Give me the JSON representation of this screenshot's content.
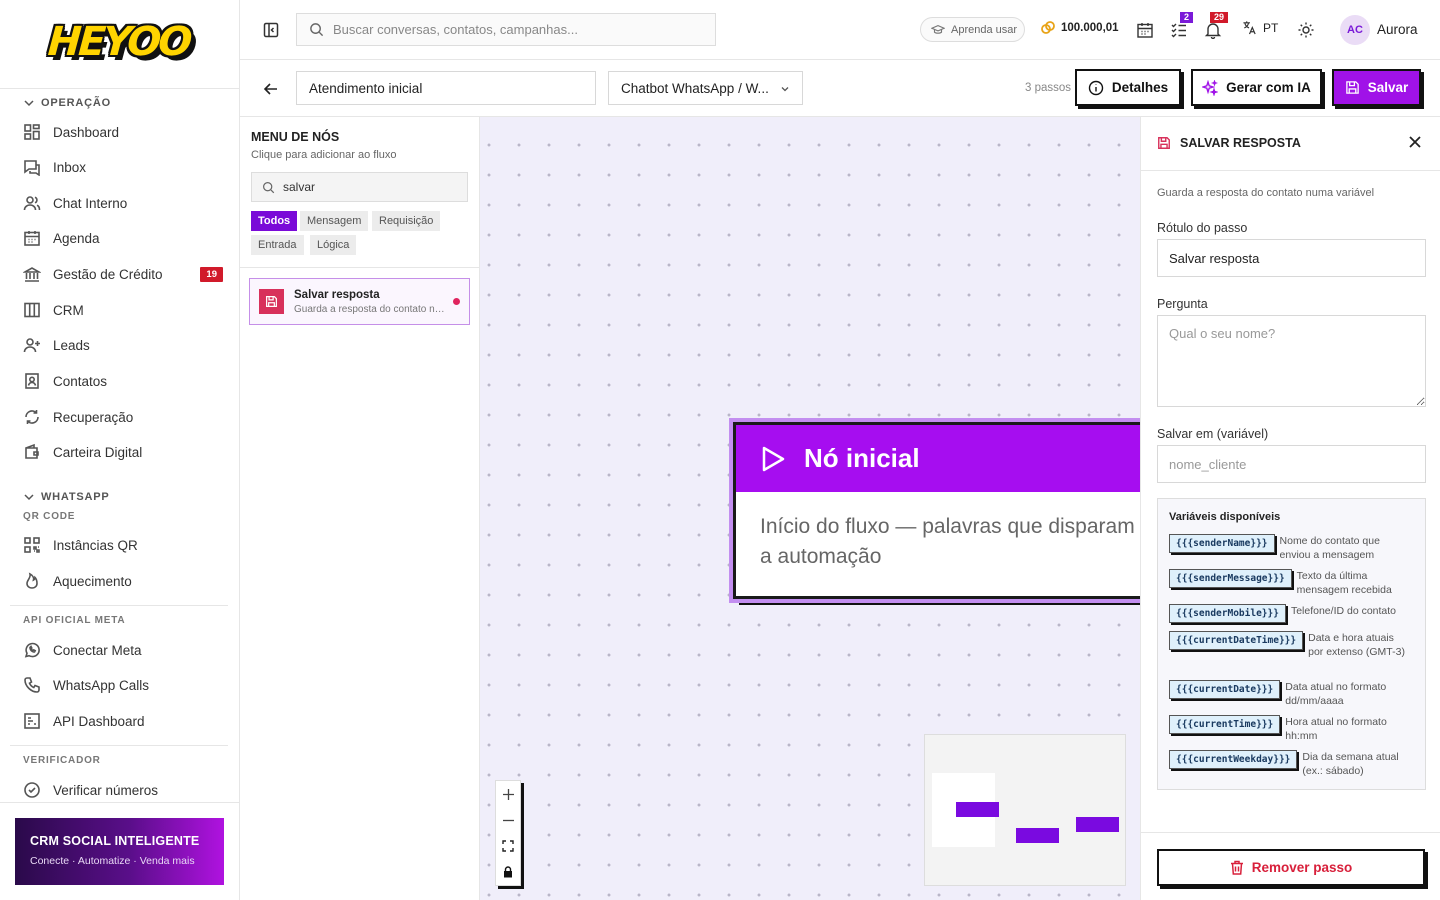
{
  "logo": "HEYOO",
  "sidebar": {
    "sections": [
      {
        "title": "OPERAÇÃO"
      },
      {
        "title": "WHATSAPP",
        "sub": "QR CODE"
      },
      {
        "title": "API OFICIAL META"
      },
      {
        "title": "VERIFICADOR"
      }
    ],
    "items": [
      {
        "label": "Dashboard",
        "icon": "dashboard-icon"
      },
      {
        "label": "Inbox",
        "icon": "inbox-icon"
      },
      {
        "label": "Chat Interno",
        "icon": "users-icon"
      },
      {
        "label": "Agenda",
        "icon": "calendar-icon"
      },
      {
        "label": "Gestão de Crédito",
        "icon": "bank-icon",
        "badge": "19"
      },
      {
        "label": "CRM",
        "icon": "columns-icon"
      },
      {
        "label": "Leads",
        "icon": "user-plus-icon"
      },
      {
        "label": "Contatos",
        "icon": "contacts-icon"
      },
      {
        "label": "Recuperação",
        "icon": "refresh-icon"
      },
      {
        "label": "Carteira Digital",
        "icon": "wallet-icon"
      },
      {
        "label": "Instâncias QR",
        "icon": "qr-icon"
      },
      {
        "label": "Aquecimento",
        "icon": "flame-icon"
      },
      {
        "label": "Conectar Meta",
        "icon": "whatsapp-icon"
      },
      {
        "label": "WhatsApp Calls",
        "icon": "phone-icon"
      },
      {
        "label": "API Dashboard",
        "icon": "api-icon"
      },
      {
        "label": "Verificar números",
        "icon": "check-circle-icon"
      }
    ],
    "promo": {
      "title": "CRM SOCIAL INTELIGENTE",
      "subtitle": "Conecte · Automatize · Venda mais"
    }
  },
  "topbar": {
    "search_placeholder": "Buscar conversas, contatos, campanhas...",
    "learn_label": "Aprenda usar",
    "balance": "100.000,01",
    "tasks_badge": "2",
    "notifications_badge": "29",
    "language": "PT",
    "avatar_initials": "AC",
    "user_name": "Aurora"
  },
  "editor": {
    "flow_name": "Atendimento inicial",
    "channel": "Chatbot WhatsApp / W...",
    "steps": "3 passos",
    "details_label": "Detalhes",
    "ai_label": "Gerar com IA",
    "save_label": "Salvar"
  },
  "node_menu": {
    "title": "MENU DE NÓS",
    "subtitle": "Clique para adicionar ao fluxo",
    "search_value": "salvar",
    "filters": [
      "Todos",
      "Mensagem",
      "Requisição",
      "Entrada",
      "Lógica"
    ],
    "active_filter": "Todos",
    "results": [
      {
        "title": "Salvar resposta",
        "desc": "Guarda a resposta do contato numa variável"
      }
    ]
  },
  "canvas": {
    "start_node": {
      "title": "Nó inicial",
      "body": "Início do fluxo — palavras que disparam a automação"
    }
  },
  "panel": {
    "title": "SALVAR RESPOSTA",
    "description": "Guarda a resposta do contato numa variável",
    "step_label_label": "Rótulo do passo",
    "step_label_value": "Salvar resposta",
    "question_label": "Pergunta",
    "question_placeholder": "Qual o seu nome?",
    "save_in_label": "Salvar em (variável)",
    "save_in_placeholder": "nome_cliente",
    "vars_title": "Variáveis disponíveis",
    "variables": [
      {
        "tag": "{{{senderName}}}",
        "desc": "Nome do contato que enviou a mensagem"
      },
      {
        "tag": "{{{senderMessage}}}",
        "desc": "Texto da última mensagem recebida"
      },
      {
        "tag": "{{{senderMobile}}}",
        "desc": "Telefone/ID do contato"
      },
      {
        "tag": "{{{currentDateTime}}}",
        "desc": "Data e hora atuais por extenso (GMT-3)"
      },
      {
        "tag": "{{{currentDate}}}",
        "desc": "Data atual no formato dd/mm/aaaa"
      },
      {
        "tag": "{{{currentTime}}}",
        "desc": "Hora atual no formato hh:mm"
      },
      {
        "tag": "{{{currentWeekday}}}",
        "desc": "Dia da semana atual (ex.: sábado)"
      }
    ],
    "remove_label": "Remover passo"
  },
  "colors": {
    "accent": "#a012e8",
    "danger": "#d8203b",
    "badge": "#7a1ad8"
  }
}
